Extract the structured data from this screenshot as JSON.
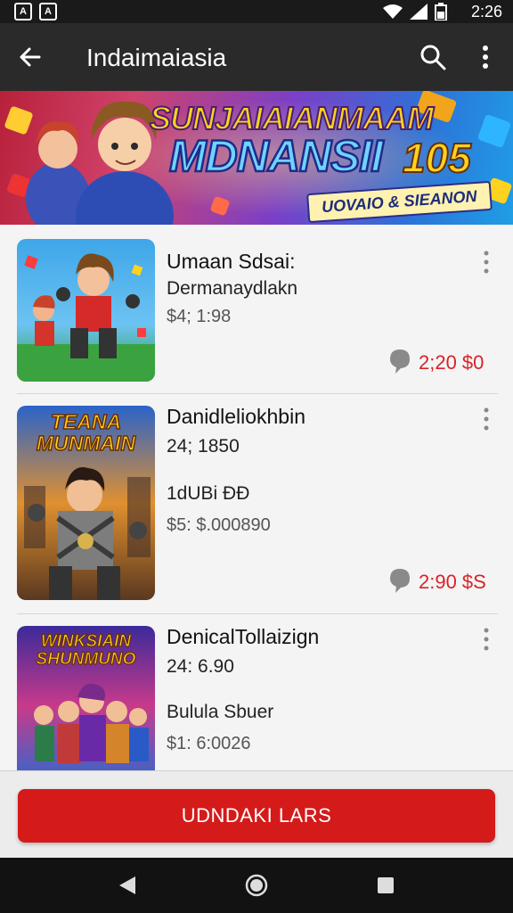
{
  "status_bar": {
    "time": "2:26",
    "left_icons": [
      "A",
      "A"
    ],
    "right_icons": [
      "wifi-icon",
      "signal-icon",
      "battery-icon"
    ]
  },
  "app_bar": {
    "title": "Indaimaiasia",
    "icons": [
      "back-arrow-icon",
      "search-icon",
      "more-vert-icon"
    ]
  },
  "banner": {
    "line1": "SUNJAIAIANMAAM",
    "line2": "MDNANSII",
    "number": "105",
    "tag": "UOVAIO & SIEANON"
  },
  "items": [
    {
      "name": "Umaan Sdsai:",
      "line2": "Dermanaydlakn",
      "line3": "",
      "price": "$4; 1:98",
      "amount": "2;20 $0",
      "thumb_title": ""
    },
    {
      "name": "Danidlelіokhbin",
      "line2": "24; 1850",
      "line3": "1dUBi ÐÐ",
      "price": "$5: $.000890",
      "amount": "2:90 $S",
      "thumb_title": "TEANA MUNMAIN"
    },
    {
      "name": "DenicalTollaizign",
      "line2": "24: 6.90",
      "line3": "Bulula Sbuer",
      "price": "$1: 6:0026",
      "amount": "",
      "thumb_title": "WINKSIAIN SHUNMUNO"
    }
  ],
  "cta": {
    "label": "UDNDAKI LARS"
  },
  "nav_bar": {
    "icons": [
      "nav-back-icon",
      "nav-home-icon",
      "nav-recents-icon"
    ]
  },
  "colors": {
    "accent": "#d51a1a",
    "app_bar": "#2a2a2a",
    "status": "#1a1a1a"
  }
}
